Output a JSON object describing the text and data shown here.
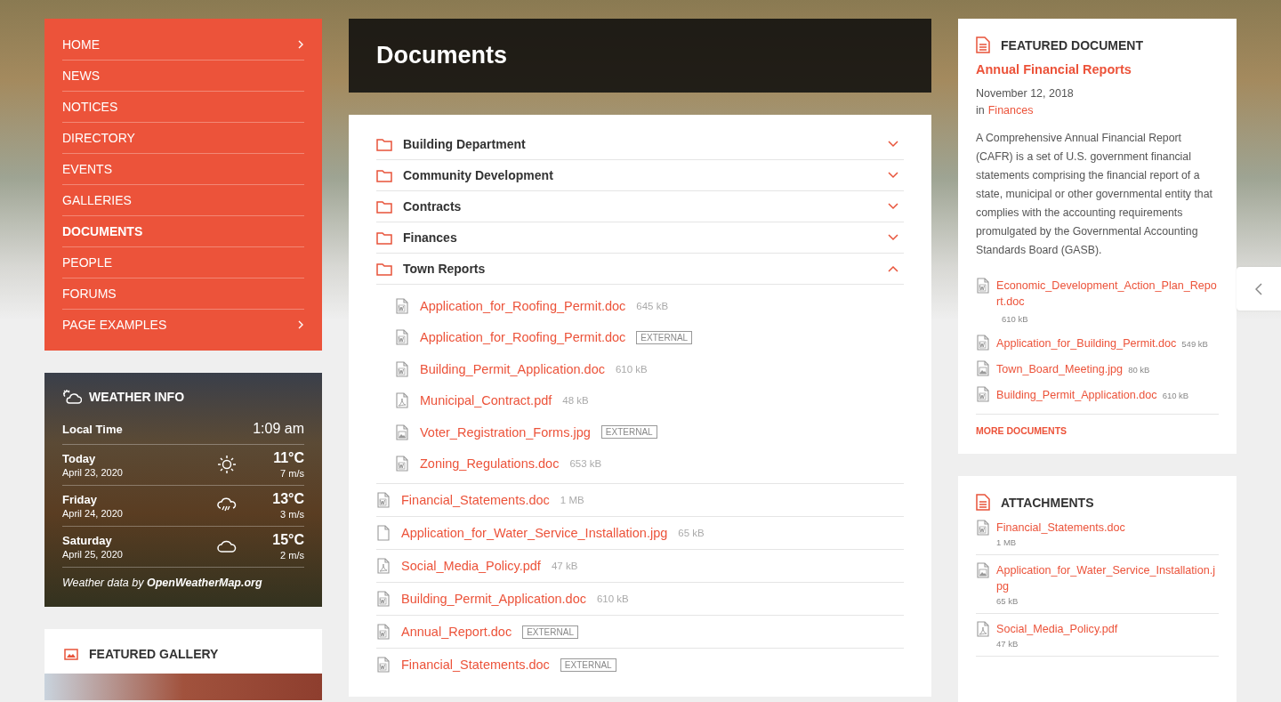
{
  "nav": {
    "items": [
      {
        "label": "HOME",
        "selected": false,
        "has_submenu": true
      },
      {
        "label": "NEWS",
        "selected": false,
        "has_submenu": false
      },
      {
        "label": "NOTICES",
        "selected": false,
        "has_submenu": false
      },
      {
        "label": "DIRECTORY",
        "selected": false,
        "has_submenu": false
      },
      {
        "label": "EVENTS",
        "selected": false,
        "has_submenu": false
      },
      {
        "label": "GALLERIES",
        "selected": false,
        "has_submenu": false
      },
      {
        "label": "DOCUMENTS",
        "selected": true,
        "has_submenu": false
      },
      {
        "label": "PEOPLE",
        "selected": false,
        "has_submenu": false
      },
      {
        "label": "FORUMS",
        "selected": false,
        "has_submenu": false
      },
      {
        "label": "PAGE EXAMPLES",
        "selected": false,
        "has_submenu": true
      }
    ]
  },
  "weather": {
    "title": "WEATHER INFO",
    "local_time_label": "Local Time",
    "local_time": "1:09 am",
    "days": [
      {
        "day": "Today",
        "date": "April 23, 2020",
        "kind": "sun",
        "temp": "11°C",
        "wind": "7 m/s"
      },
      {
        "day": "Friday",
        "date": "April 24, 2020",
        "kind": "rain",
        "temp": "13°C",
        "wind": "3 m/s"
      },
      {
        "day": "Saturday",
        "date": "April 25, 2020",
        "kind": "cloud",
        "temp": "15°C",
        "wind": "2 m/s"
      }
    ],
    "credit": "Weather data by **OpenWeatherMap.org**"
  },
  "gallery": {
    "title": "FEATURED GALLERY"
  },
  "documents": {
    "title": "Documents",
    "folders": [
      {
        "name": "Building Department",
        "expanded": false
      },
      {
        "name": "Community Development",
        "expanded": false
      },
      {
        "name": "Contracts",
        "expanded": false
      },
      {
        "name": "Finances",
        "expanded": false
      },
      {
        "name": "Town Reports",
        "expanded": true,
        "files": [
          {
            "name": "Application_for_Roofing_Permit.doc",
            "kind": "word",
            "size": "645 kB"
          },
          {
            "name": "Application_for_Roofing_Permit.doc",
            "kind": "word",
            "tag": "EXTERNAL"
          },
          {
            "name": "Building_Permit_Application.doc",
            "kind": "word",
            "size": "610 kB"
          },
          {
            "name": "Municipal_Contract.pdf",
            "kind": "pdf",
            "size": "48 kB"
          },
          {
            "name": "Voter_Registration_Forms.jpg",
            "kind": "image",
            "tag": "EXTERNAL"
          },
          {
            "name": "Zoning_Regulations.doc",
            "kind": "word",
            "size": "653 kB"
          }
        ]
      }
    ],
    "files": [
      {
        "name": "Financial_Statements.doc",
        "kind": "word",
        "size": "1 MB"
      },
      {
        "name": "Application_for_Water_Service_Installation.jpg",
        "kind": "blank",
        "size": "65 kB"
      },
      {
        "name": "Social_Media_Policy.pdf",
        "kind": "pdf",
        "size": "47 kB"
      },
      {
        "name": "Building_Permit_Application.doc",
        "kind": "word",
        "size": "610 kB"
      },
      {
        "name": "Annual_Report.doc",
        "kind": "word",
        "tag": "EXTERNAL"
      },
      {
        "name": "Financial_Statements.doc",
        "kind": "word",
        "tag": "EXTERNAL"
      }
    ]
  },
  "featured": {
    "title": "FEATURED DOCUMENT",
    "doc_title": "Annual Financial Reports",
    "date": "November 12, 2018",
    "category_prefix": "in",
    "category": "Finances",
    "description": "A Comprehensive Annual Financial Report (CAFR) is a set of U.S. government financial statements comprising the financial report of a state, municipal or other governmental entity that complies with the accounting requirements promulgated by the Governmental Accounting Standards Board (GASB).",
    "files": [
      {
        "name": "Economic_Development_Action_Plan_Report.doc",
        "kind": "word",
        "size": "610 kB"
      },
      {
        "name": "Application_for_Building_Permit.doc",
        "kind": "word",
        "size": "549 kB"
      },
      {
        "name": "Town_Board_Meeting.jpg",
        "kind": "image",
        "size": "80 kB"
      },
      {
        "name": "Building_Permit_Application.doc",
        "kind": "word",
        "size": "610 kB"
      }
    ],
    "more": "MORE DOCUMENTS"
  },
  "attachments": {
    "title": "ATTACHMENTS",
    "files": [
      {
        "name": "Financial_Statements.doc",
        "kind": "word",
        "size": "1 MB"
      },
      {
        "name": "Application_for_Water_Service_Installation.jpg",
        "kind": "image",
        "size": "65 kB"
      },
      {
        "name": "Social_Media_Policy.pdf",
        "kind": "pdf",
        "size": "47 kB"
      }
    ]
  }
}
